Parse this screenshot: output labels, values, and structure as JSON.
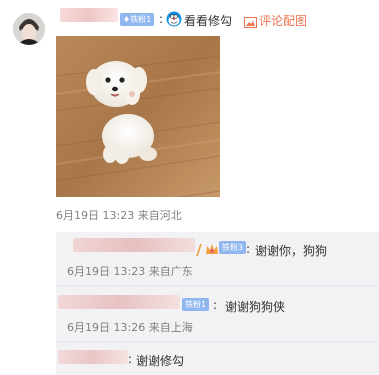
{
  "post": {
    "badge": "铁粉1",
    "action_label": "看看修勾",
    "repost_label": "评论配图",
    "meta": "6月19日 13:23 来自河北"
  },
  "replies": [
    {
      "badge": "铁粉3",
      "text": "谢谢你，狗狗",
      "meta": "6月19日 13:23 来自广东"
    },
    {
      "badge": "铁粉1",
      "text": "谢谢狗狗侠",
      "meta": "6月19日 13:26 来自上海"
    },
    {
      "text": "谢谢修勾"
    }
  ],
  "icons": {
    "action": "doraemon-icon",
    "repost": "image-icon",
    "badge_icon": "fan-badge-icon"
  },
  "colors": {
    "accent": "#eb7350",
    "badge_blue": "#8fb6ef",
    "reply_bg": "#f2f2f5"
  }
}
